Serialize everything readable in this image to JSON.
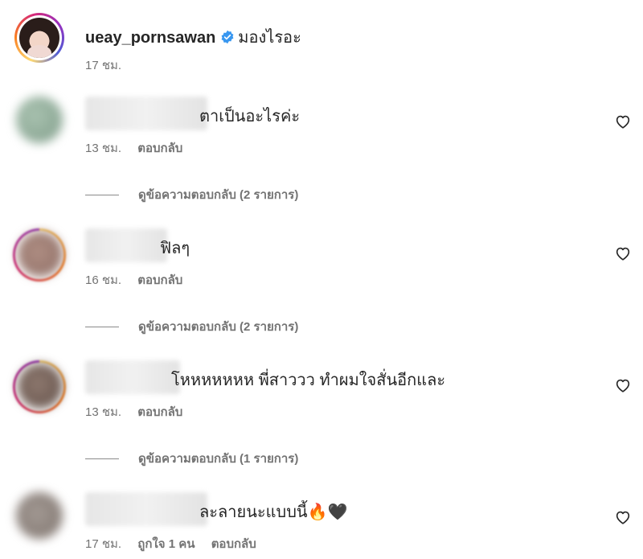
{
  "caption": {
    "username": "ueay_pornsawan",
    "text": "มองไรอะ",
    "time": "17 ชม.",
    "verified_icon": "verified-badge-icon",
    "accent": "#3897f0"
  },
  "comments": [
    {
      "text": "ตาเป็นอะไรค่ะ",
      "time": "13 ชม.",
      "reply_label": "ตอบกลับ",
      "view_replies": "ดูข้อความตอบกลับ (2 รายการ)"
    },
    {
      "text": "ฟิลๆ",
      "time": "16 ชม.",
      "reply_label": "ตอบกลับ",
      "view_replies": "ดูข้อความตอบกลับ (2 รายการ)"
    },
    {
      "text": "โหหหหหหห พี่สาววว ทำผมใจสั่นอีกและ",
      "time": "13 ชม.",
      "reply_label": "ตอบกลับ",
      "view_replies": "ดูข้อความตอบกลับ (1 รายการ)"
    },
    {
      "text": "ละลายนะแบบนี้🔥🖤",
      "time": "17 ชม.",
      "likes": "ถูกใจ 1 คน",
      "reply_label": "ตอบกลับ"
    }
  ],
  "icons": {
    "like": "heart-outline-icon"
  }
}
